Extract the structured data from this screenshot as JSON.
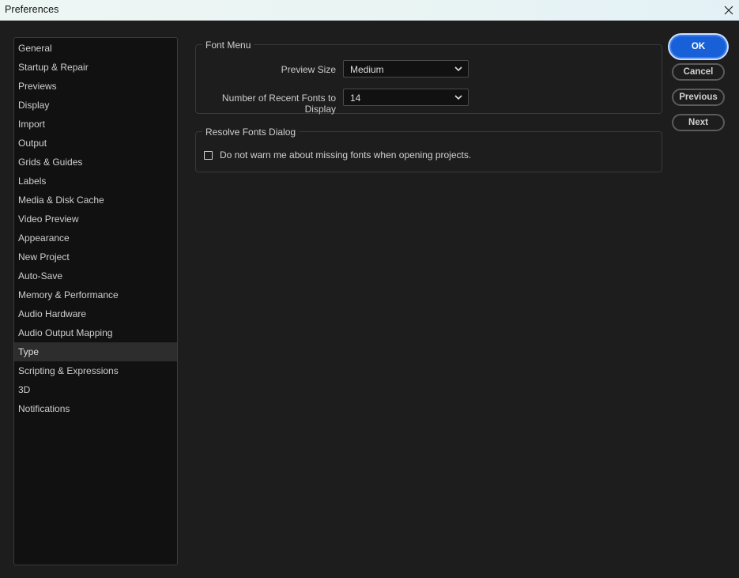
{
  "window": {
    "title": "Preferences"
  },
  "sidebar": {
    "items": [
      {
        "label": "General"
      },
      {
        "label": "Startup & Repair"
      },
      {
        "label": "Previews"
      },
      {
        "label": "Display"
      },
      {
        "label": "Import"
      },
      {
        "label": "Output"
      },
      {
        "label": "Grids & Guides"
      },
      {
        "label": "Labels"
      },
      {
        "label": "Media & Disk Cache"
      },
      {
        "label": "Video Preview"
      },
      {
        "label": "Appearance"
      },
      {
        "label": "New Project"
      },
      {
        "label": "Auto-Save"
      },
      {
        "label": "Memory & Performance"
      },
      {
        "label": "Audio Hardware"
      },
      {
        "label": "Audio Output Mapping"
      },
      {
        "label": "Type",
        "selected": true
      },
      {
        "label": "Scripting & Expressions"
      },
      {
        "label": "3D"
      },
      {
        "label": "Notifications"
      }
    ]
  },
  "font_menu": {
    "legend": "Font Menu",
    "preview_size": {
      "label": "Preview Size",
      "value": "Medium"
    },
    "recent_fonts": {
      "label": "Number of Recent Fonts to Display",
      "value": "14"
    }
  },
  "resolve_fonts": {
    "legend": "Resolve Fonts Dialog",
    "warn_missing": {
      "label": "Do not warn me about missing fonts when opening projects.",
      "checked": false
    }
  },
  "buttons": {
    "ok": "OK",
    "cancel": "Cancel",
    "previous": "Previous",
    "next": "Next"
  },
  "colors": {
    "background": "#1d1d1d",
    "sidebar_bg": "#111111",
    "primary_button": "#1860d8"
  }
}
